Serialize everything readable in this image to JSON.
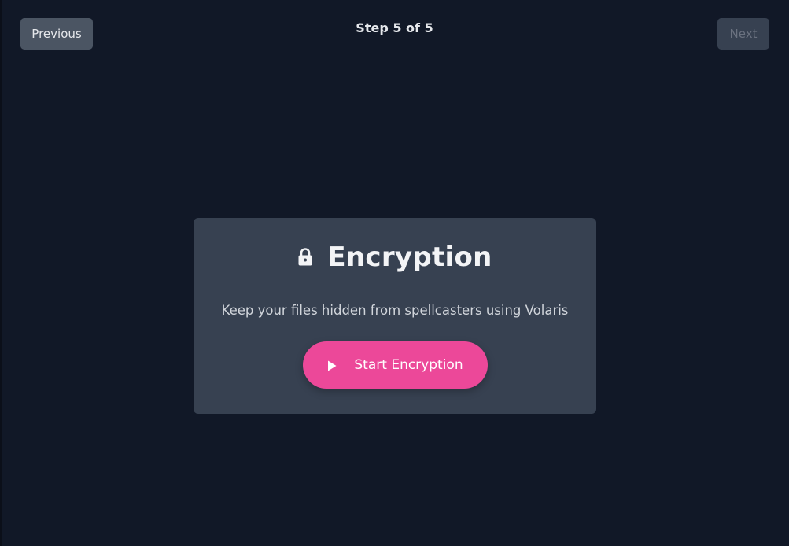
{
  "nav": {
    "previous_label": "Previous",
    "step_label": "Step 5 of 5",
    "next_label": "Next"
  },
  "card": {
    "icon": "lock-icon",
    "title": "Encryption",
    "description": "Keep your files hidden from spellcasters using Volaris",
    "button_icon": "play-icon",
    "button_label": "Start Encryption"
  },
  "colors": {
    "background": "#111827",
    "card": "#374151",
    "accent": "#ec4899",
    "previous_button": "#4b5563",
    "next_button_disabled": "#374151"
  }
}
